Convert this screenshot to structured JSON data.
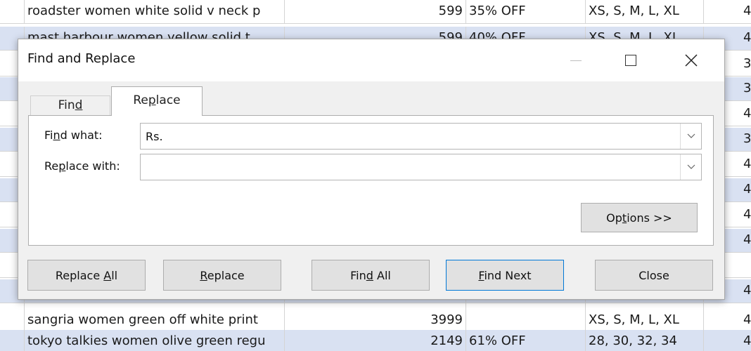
{
  "sheet": {
    "rows": [
      {
        "name": "roadster women white solid v neck p",
        "price": "599",
        "discount": "35% OFF",
        "sizes": "XS, S, M, L, XL",
        "last": "4"
      },
      {
        "name": "mast  harbour women yellow solid t",
        "price": "599",
        "discount": "40% OFF",
        "sizes": "XS, S, M, L, XL",
        "last": "4"
      },
      {
        "name": "",
        "price": "",
        "discount": "",
        "sizes": "",
        "last": "3"
      },
      {
        "name": "",
        "price": "",
        "discount": "",
        "sizes": "",
        "last": "3"
      },
      {
        "name": "",
        "price": "",
        "discount": "",
        "sizes": "",
        "last": "4"
      },
      {
        "name": "",
        "price": "",
        "discount": "",
        "sizes": "",
        "last": "3"
      },
      {
        "name": "",
        "price": "",
        "discount": "",
        "sizes": "",
        "last": "4"
      },
      {
        "name": "",
        "price": "",
        "discount": "",
        "sizes": "",
        "last": "4"
      },
      {
        "name": "",
        "price": "",
        "discount": "",
        "sizes": "",
        "last": "4"
      },
      {
        "name": "",
        "price": "",
        "discount": "",
        "sizes": "",
        "last": "4"
      },
      {
        "name": "",
        "price": "",
        "discount": "",
        "sizes": "",
        "last": ""
      },
      {
        "name": "",
        "price": "",
        "discount": "",
        "sizes": "",
        "last": "4"
      },
      {
        "name": "",
        "price": "",
        "discount": "",
        "sizes": "",
        "last": "4"
      },
      {
        "name": "sangria women green  off white print",
        "price": "3999",
        "discount": "",
        "sizes": "XS, S, M, L, XL",
        "last": "4"
      },
      {
        "name": "tokyo talkies women olive green regu",
        "price": "2149",
        "discount": "61% OFF",
        "sizes": "28, 30, 32, 34",
        "last": "4"
      }
    ]
  },
  "dialog": {
    "title": "Find and Replace",
    "tabs": {
      "find": {
        "pre": "Fin",
        "key": "d",
        "post": ""
      },
      "replace": {
        "pre": "Re",
        "key": "p",
        "post": "lace"
      }
    },
    "find_what": {
      "label_pre": "Fi",
      "label_key": "n",
      "label_post": "d what:",
      "value": "Rs."
    },
    "replace_with": {
      "label_pre": "Re",
      "label_key": "p",
      "label_post": "lace with:",
      "value": ""
    },
    "buttons": {
      "options": {
        "pre": "Op",
        "key": "t",
        "post": "ions >>"
      },
      "replace_all": {
        "pre": "Replace ",
        "key": "A",
        "post": "ll"
      },
      "replace": {
        "pre": "",
        "key": "R",
        "post": "eplace"
      },
      "find_all": {
        "pre": "Fin",
        "key": "d",
        "post": " All"
      },
      "find_next": {
        "pre": "",
        "key": "F",
        "post": "ind Next"
      },
      "close": {
        "pre": "Close",
        "key": "",
        "post": ""
      }
    }
  },
  "colors": {
    "band": "#d9e1f2",
    "accent": "#0078d7"
  }
}
